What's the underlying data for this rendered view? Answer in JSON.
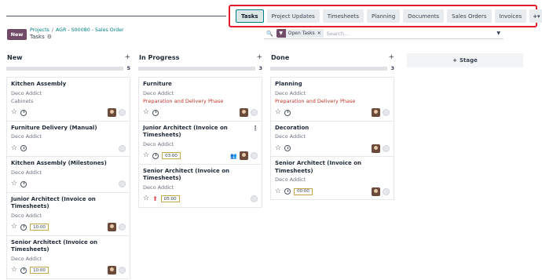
{
  "tabs": [
    {
      "label": "Tasks",
      "active": true
    },
    {
      "label": "Project Updates"
    },
    {
      "label": "Timesheets"
    },
    {
      "label": "Planning"
    },
    {
      "label": "Documents"
    },
    {
      "label": "Sales Orders"
    },
    {
      "label": "Invoices"
    }
  ],
  "tab_more": "+▾",
  "new_button": "New",
  "breadcrumb": {
    "projects": "Projects",
    "order": "AGR - S00080 - Sales Order"
  },
  "subtitle": "Tasks",
  "search": {
    "facet": "Open Tasks",
    "placeholder": "Search..."
  },
  "columns": [
    {
      "title": "New",
      "count": "5",
      "cards": [
        {
          "title": "Kitchen Assembly",
          "customer": "Deco Addict",
          "tag": "Cabinets",
          "avatar": true
        },
        {
          "title": "Furniture Delivery (Manual)",
          "customer": "Deco Addict"
        },
        {
          "title": "Kitchen Assembly (Milestones)",
          "customer": "Deco Addict"
        },
        {
          "title": "Junior Architect (Invoice on Timesheets)",
          "customer": "Deco Addict",
          "deadline": "10:00",
          "avatar": true
        },
        {
          "title": "Senior Architect (Invoice on Timesheets)",
          "customer": "Deco Addict",
          "deadline": "10:00",
          "avatar": true
        }
      ]
    },
    {
      "title": "In Progress",
      "count": "3",
      "cards": [
        {
          "title": "Furniture",
          "customer": "Deco Addict",
          "tag": "Preparation and Delivery Phase",
          "avatar": true
        },
        {
          "title": "Junior Architect (Invoice on Timesheets)",
          "customer": "Deco Addict",
          "deadline": "03:00",
          "avatar": true,
          "people": true,
          "kebab": true
        },
        {
          "title": "Senior Architect (Invoice on Timesheets)",
          "customer": "Deco Addict",
          "deadline": "05:00",
          "upload": true
        }
      ]
    },
    {
      "title": "Done",
      "count": "3",
      "cards": [
        {
          "title": "Planning",
          "customer": "Deco Addict",
          "tag": "Preparation and Delivery Phase",
          "avatar": true
        },
        {
          "title": "Decoration",
          "customer": "Deco Addict",
          "avatar": true
        },
        {
          "title": "Senior Architect (Invoice on Timesheets)",
          "customer": "Deco Addict",
          "deadline": "00:00",
          "avatar": true
        }
      ]
    }
  ],
  "stage_button": "Stage",
  "colors": {
    "accent": "#714b67",
    "teal": "#017e84",
    "tag_red": "#c0392b",
    "highlight": "#e11d2e"
  }
}
